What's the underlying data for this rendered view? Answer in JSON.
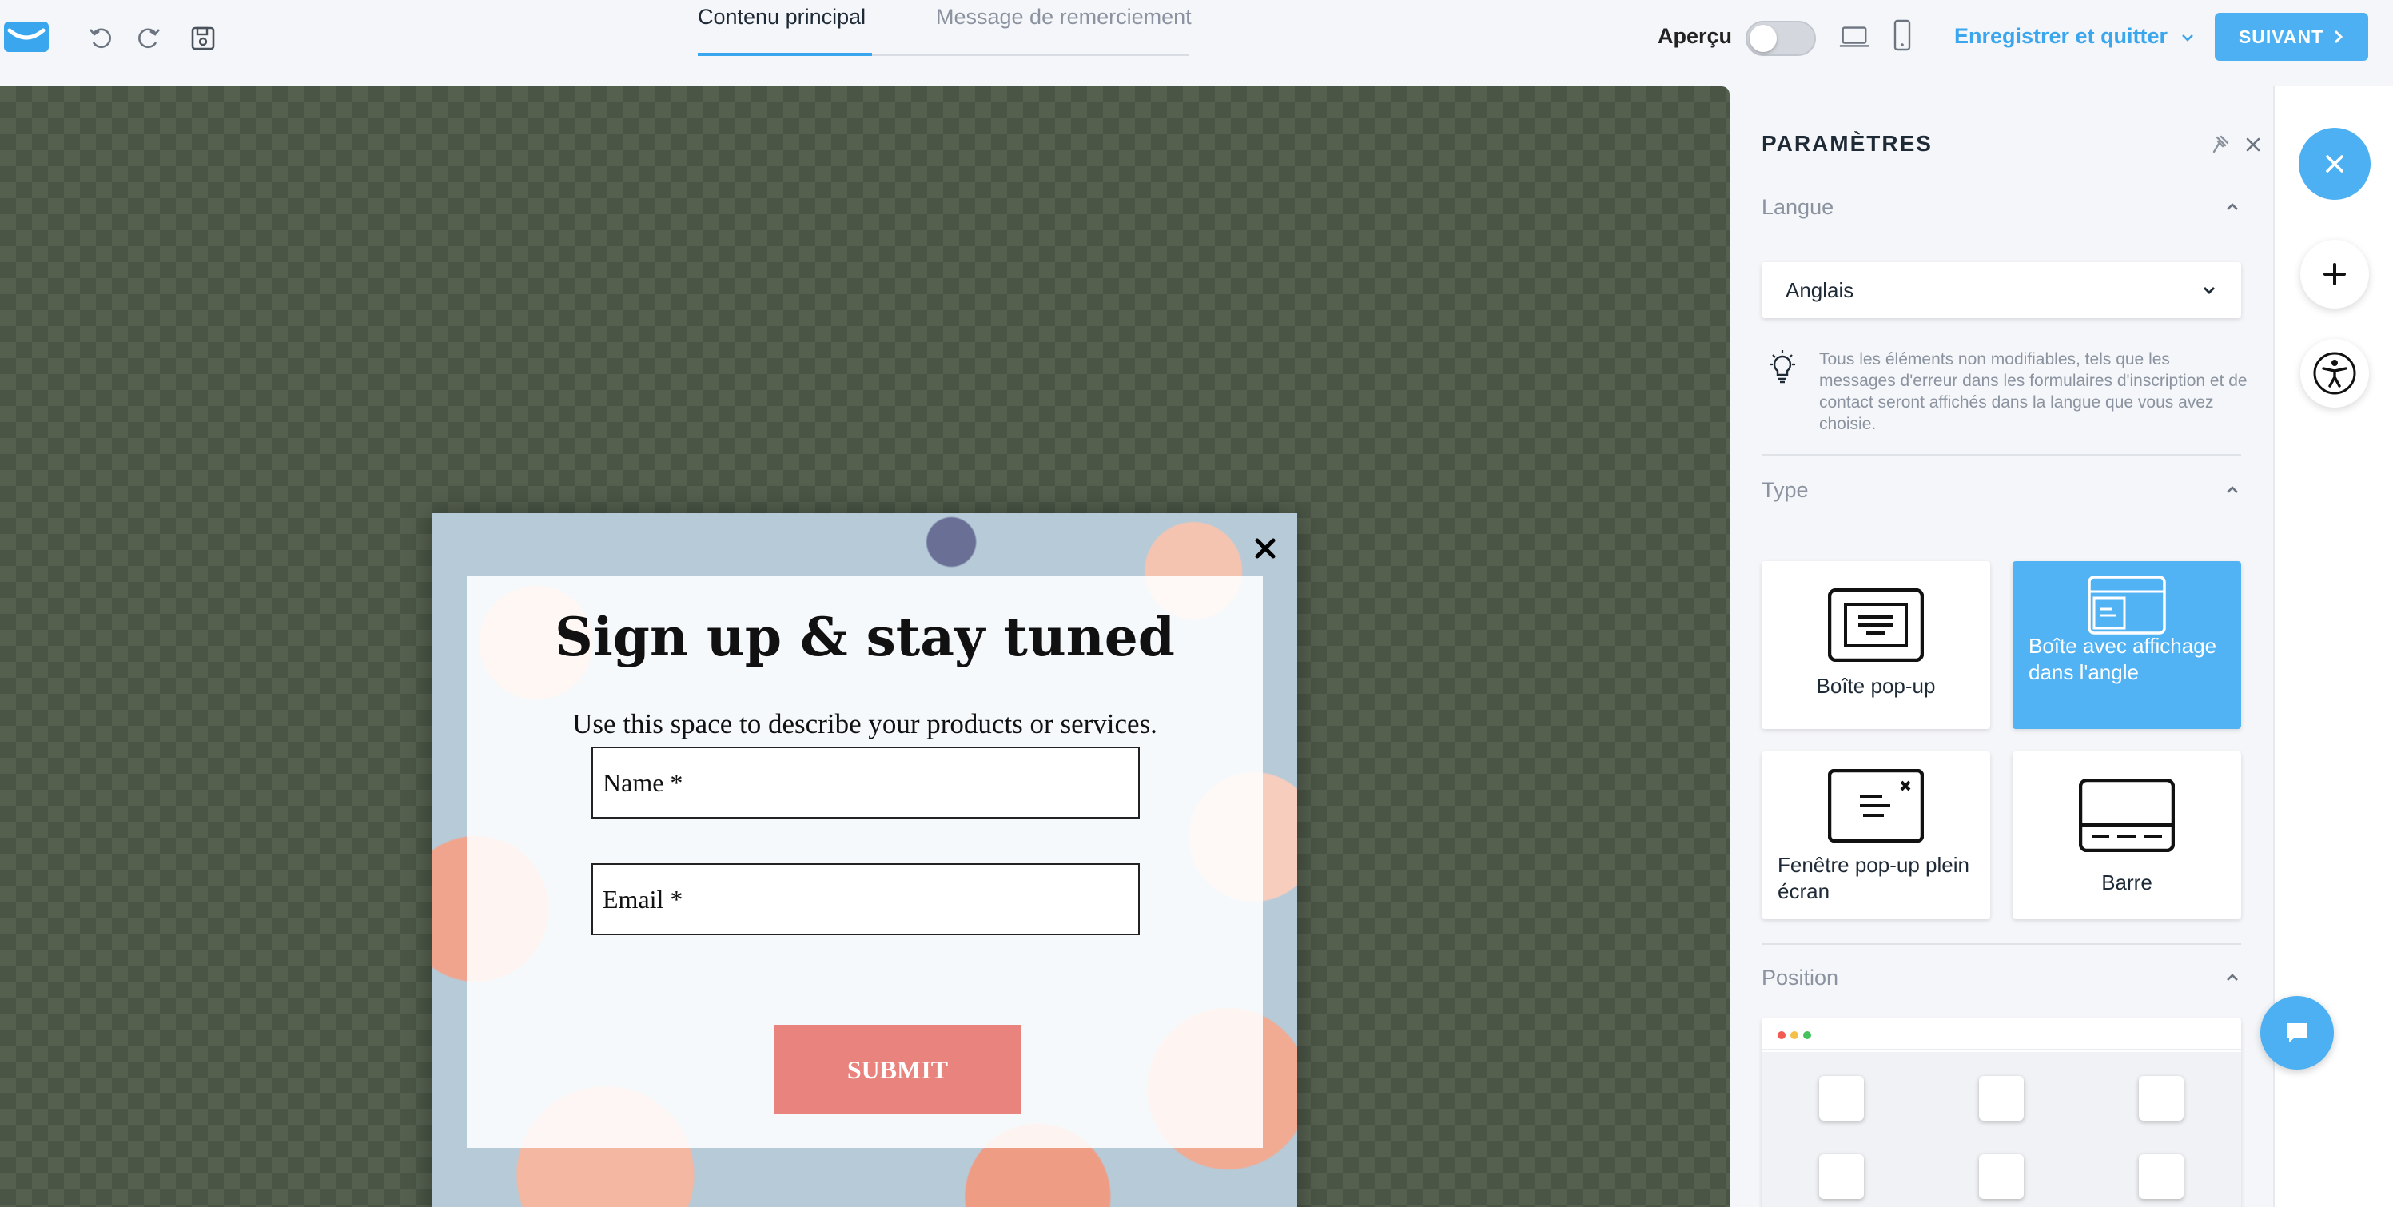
{
  "colors": {
    "accent": "#4cb0f2",
    "canvas": "#55604f",
    "submit": "#e8847d"
  },
  "topbar": {
    "tabs": [
      {
        "label": "Contenu principal",
        "active": true
      },
      {
        "label": "Message de remerciement",
        "active": false
      }
    ],
    "preview_label": "Aperçu",
    "preview_enabled": false,
    "save_quit_label": "Enregistrer et quitter",
    "next_label": "SUIVANT",
    "icons": [
      "logo-icon",
      "undo-icon",
      "redo-icon",
      "save-icon",
      "desktop-icon",
      "mobile-icon"
    ]
  },
  "popup": {
    "title": "Sign up & stay tuned",
    "description": "Use this space to describe your products or services.",
    "name_placeholder": "Name *",
    "email_placeholder": "Email *",
    "submit_label": "SUBMIT"
  },
  "settings": {
    "title": "PARAMÈTRES",
    "language": {
      "heading": "Langue",
      "selected": "Anglais",
      "hint": "Tous les éléments non modifiables, tels que les messages d'erreur dans les formulaires d'inscription et de contact seront affichés dans la langue que vous avez choisie."
    },
    "type": {
      "heading": "Type",
      "options": [
        {
          "label": "Boîte pop-up",
          "selected": false
        },
        {
          "label": "Boîte avec affichage dans l'angle",
          "selected": true
        },
        {
          "label": "Fenêtre pop-up plein écran",
          "selected": false
        },
        {
          "label": "Barre",
          "selected": false
        }
      ]
    },
    "position": {
      "heading": "Position"
    }
  },
  "rail": {
    "icons": [
      "close-icon",
      "plus-icon",
      "accessibility-icon",
      "chat-icon"
    ]
  }
}
